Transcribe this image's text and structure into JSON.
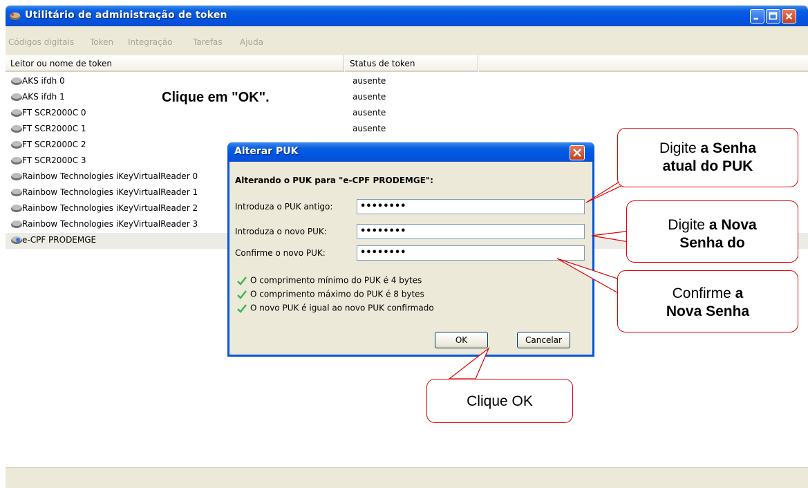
{
  "window": {
    "title": "Utilitário de administração de token",
    "controls": {
      "minimize": "minimize-icon",
      "maximize": "maximize-icon",
      "close": "close-icon"
    }
  },
  "menu": [
    "Códigos digitais",
    "Token",
    "Integração",
    "Tarefas",
    "Ajuda"
  ],
  "columns": [
    "Leitor ou nome de token",
    "Status de token"
  ],
  "rows": [
    {
      "name": "AKS ifdh 0",
      "status": "ausente"
    },
    {
      "name": "AKS ifdh 1",
      "status": "ausente"
    },
    {
      "name": "FT SCR2000C 0",
      "status": "ausente"
    },
    {
      "name": "FT SCR2000C 1",
      "status": "ausente"
    },
    {
      "name": "FT SCR2000C 2",
      "status": ""
    },
    {
      "name": "FT SCR2000C 3",
      "status": ""
    },
    {
      "name": "Rainbow Technologies iKeyVirtualReader 0",
      "status": ""
    },
    {
      "name": "Rainbow Technologies iKeyVirtualReader 1",
      "status": ""
    },
    {
      "name": "Rainbow Technologies iKeyVirtualReader 2",
      "status": ""
    },
    {
      "name": "Rainbow Technologies iKeyVirtualReader 3",
      "status": ""
    },
    {
      "name": "e-CPF PRODEMGE",
      "status": ""
    }
  ],
  "instruction": "Clique em \"OK\".",
  "dialog": {
    "title": "Alterar PUK",
    "heading": "Alterando o PUK para \"e-CPF PRODEMGE\":",
    "fields": [
      {
        "label": "Introduza o PUK antigo:",
        "value": "••••••••"
      },
      {
        "label": "Introduza o novo PUK:",
        "value": "••••••••"
      },
      {
        "label": "Confirme o novo PUK:",
        "value": "••••••••"
      }
    ],
    "checks": [
      "O comprimento mínimo do PUK é 4 bytes",
      "O comprimento máximo do PUK é 8 bytes",
      "O novo PUK é igual ao novo PUK confirmado"
    ],
    "ok_label": "OK",
    "cancel_label": "Cancelar"
  },
  "callouts": {
    "old_puk": {
      "plain1": "Digite ",
      "bold1": "a Senha",
      "bold2": "atual do PUK"
    },
    "new_puk": {
      "plain1": "Digite ",
      "bold1": "a Nova",
      "bold2": "Senha do"
    },
    "confirm": {
      "plain1": "Confirme ",
      "bold1": "a",
      "bold2": "Nova  Senha"
    },
    "ok": {
      "text": "Clique OK"
    }
  },
  "colors": {
    "titlebar": "#0054e3",
    "callout_border": "#e00000",
    "check": "#3bb84a"
  }
}
